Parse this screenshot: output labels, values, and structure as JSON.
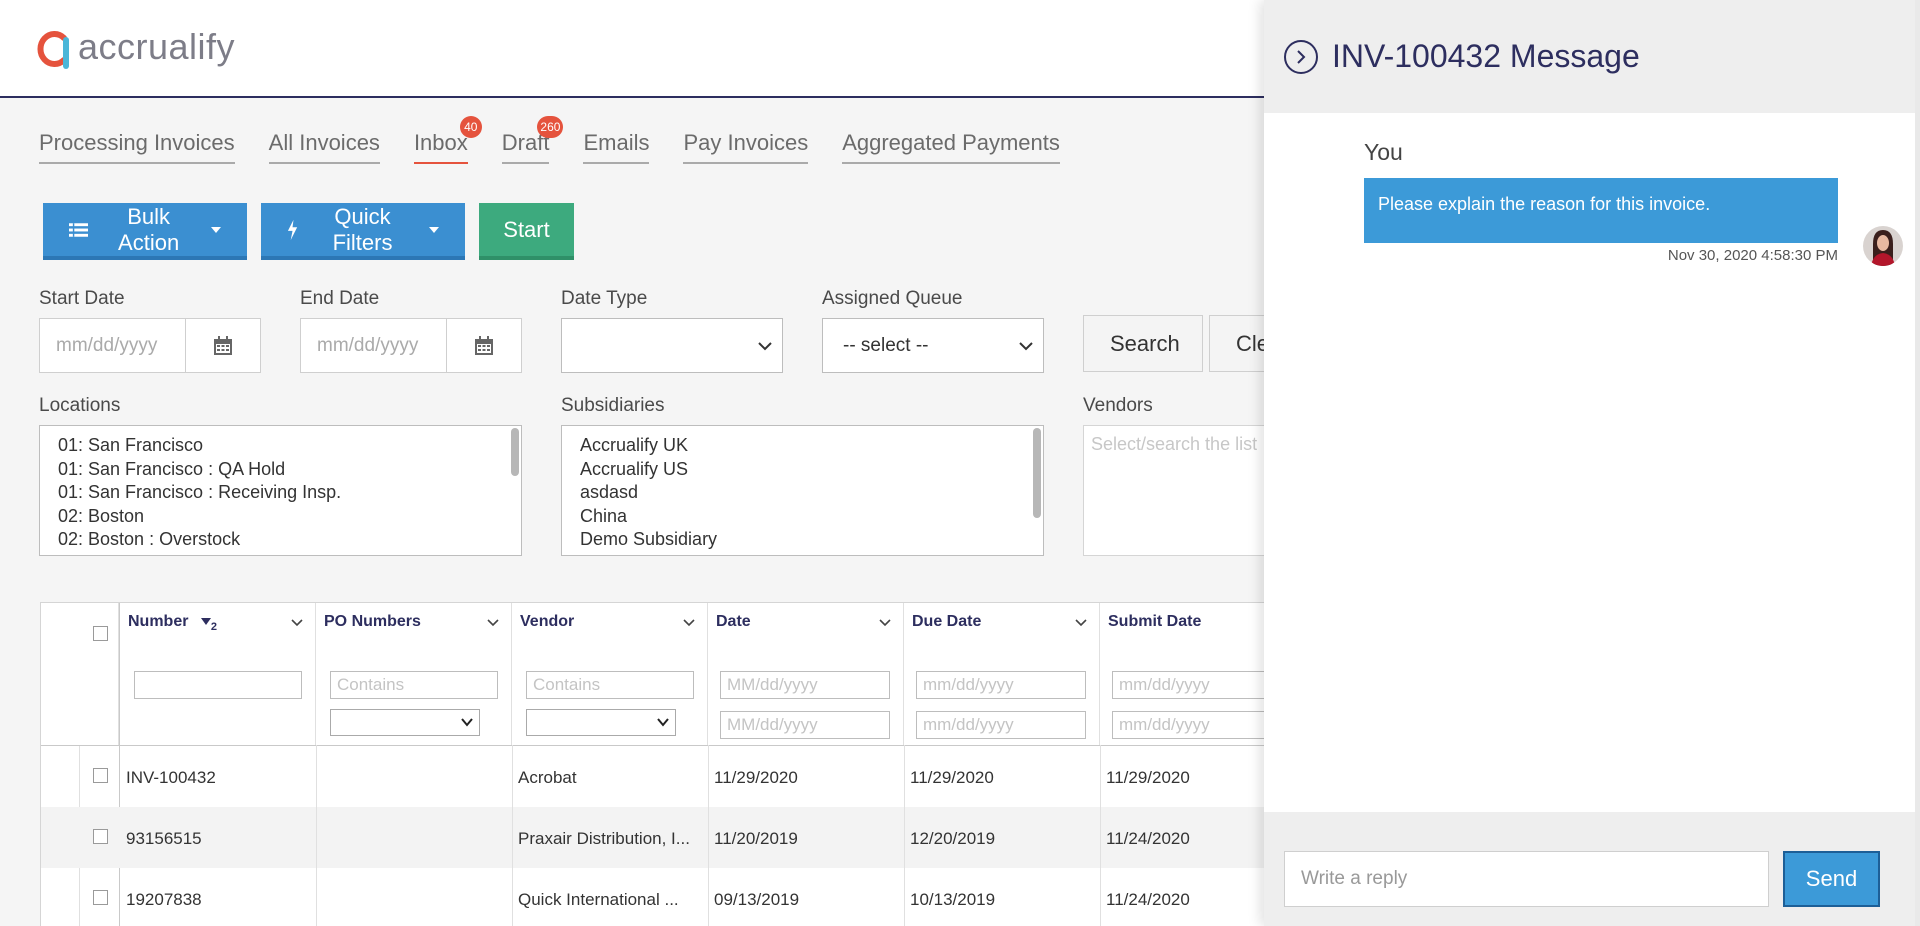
{
  "brand": {
    "logo_text": "accrualify",
    "accent": "#e5533d",
    "navy": "#2d2e5f",
    "blue": "#3b8fd1",
    "green": "#3daa7e"
  },
  "tabs": [
    {
      "label": "Processing Invoices",
      "badge": ""
    },
    {
      "label": "All Invoices",
      "badge": ""
    },
    {
      "label": "Inbox",
      "badge": "40",
      "active": true
    },
    {
      "label": "Draft",
      "badge": "260"
    },
    {
      "label": "Emails",
      "badge": ""
    },
    {
      "label": "Pay Invoices",
      "badge": ""
    },
    {
      "label": "Aggregated Payments",
      "badge": ""
    }
  ],
  "actions": {
    "bulk_action": "Bulk Action",
    "quick_filters": "Quick Filters",
    "start": "Start"
  },
  "filters": {
    "start_date_label": "Start Date",
    "start_date_placeholder": "mm/dd/yyyy",
    "end_date_label": "End Date",
    "end_date_placeholder": "mm/dd/yyyy",
    "date_type_label": "Date Type",
    "date_type_value": "",
    "assigned_queue_label": "Assigned Queue",
    "assigned_queue_value": "-- select --",
    "search_label": "Search",
    "clear_label": "Cle",
    "locations_label": "Locations",
    "locations": [
      "01: San Francisco",
      "01: San Francisco : QA Hold",
      "01: San Francisco : Receiving Insp.",
      "02: Boston",
      "02: Boston : Overstock"
    ],
    "subsidiaries_label": "Subsidiaries",
    "subsidiaries": [
      "Accrualify UK",
      "Accrualify US",
      "asdasd",
      "China",
      "Demo Subsidiary"
    ],
    "vendors_label": "Vendors",
    "vendors_placeholder": "Select/search the list"
  },
  "grid": {
    "columns": [
      {
        "title": "Number",
        "sort": "2"
      },
      {
        "title": "PO Numbers"
      },
      {
        "title": "Vendor"
      },
      {
        "title": "Date"
      },
      {
        "title": "Due Date"
      },
      {
        "title": "Submit Date"
      }
    ],
    "filter_placeholders": {
      "contains": "Contains",
      "date_upper": "MM/dd/yyyy",
      "date_lower": "mm/dd/yyyy"
    },
    "rows": [
      {
        "number": "INV-100432",
        "po": "",
        "vendor": "Acrobat",
        "date": "11/29/2020",
        "due": "11/29/2020",
        "submit": "11/29/2020"
      },
      {
        "number": "93156515",
        "po": "",
        "vendor": "Praxair Distribution, I...",
        "date": "11/20/2019",
        "due": "12/20/2019",
        "submit": "11/24/2020"
      },
      {
        "number": "19207838",
        "po": "",
        "vendor": "Quick International ...",
        "date": "09/13/2019",
        "due": "10/13/2019",
        "submit": "11/24/2020"
      }
    ]
  },
  "panel": {
    "title": "INV-100432 Message",
    "messages": [
      {
        "sender": "You",
        "text": "Please explain the reason for this invoice.",
        "time": "Nov 30, 2020 4:58:30 PM"
      }
    ],
    "reply_placeholder": "Write a reply",
    "send_label": "Send",
    "bubble_color": "#3c9ad8"
  }
}
